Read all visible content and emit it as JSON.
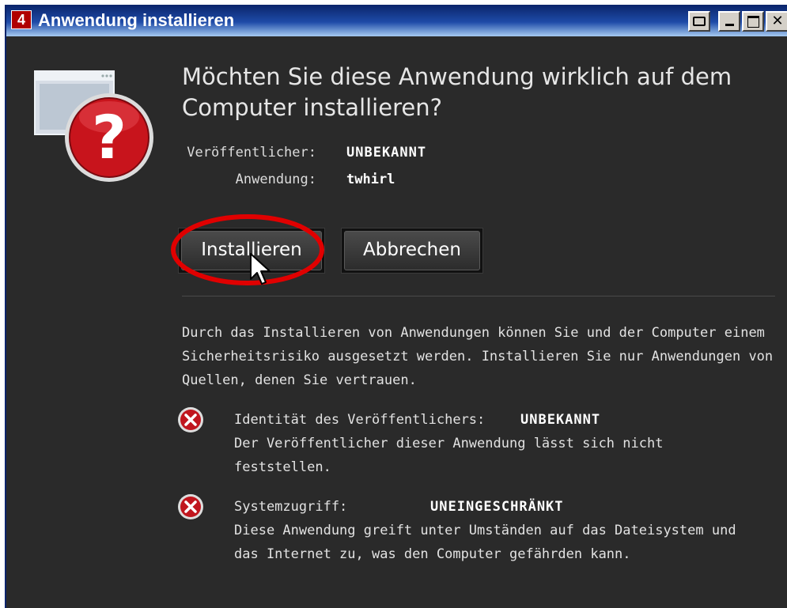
{
  "window": {
    "title": "Anwendung installieren",
    "app_icon_glyph": "4",
    "icons": [
      "print-icon",
      "minimize-icon",
      "maximize-icon",
      "close-icon"
    ]
  },
  "dialog": {
    "heading": "Möchten Sie diese Anwendung wirklich auf dem Computer installieren?",
    "hero_icon": "install-question-icon",
    "publisher_label": "Veröffentlicher:",
    "publisher_value": "UNBEKANNT",
    "application_label": "Anwendung:",
    "application_value": "twhirl",
    "install_button": "Installieren",
    "cancel_button": "Abbrechen",
    "warning_text": "Durch das Installieren von Anwendungen können Sie und der Computer einem Sicherheitsrisiko ausgesetzt werden. Installieren Sie nur Anwendungen von Quellen, denen Sie vertrauen.",
    "risks": [
      {
        "label": "Identität des Veröffentlichers:",
        "status": "UNBEKANNT",
        "description": "Der Veröffentlicher dieser Anwendung lässt sich nicht feststellen.",
        "icon": "error-x-icon"
      },
      {
        "label": "Systemzugriff:",
        "status": "UNEINGESCHRÄNKT",
        "description": "Diese Anwendung greift unter Umständen auf das Dateisystem und das Internet zu, was den Computer gefährden kann.",
        "icon": "error-x-icon"
      }
    ]
  },
  "colors": {
    "background": "#2a2a2a",
    "titlebar": "#0a246a",
    "highlight_ring": "#e00000",
    "error_icon": "#c0161e"
  }
}
